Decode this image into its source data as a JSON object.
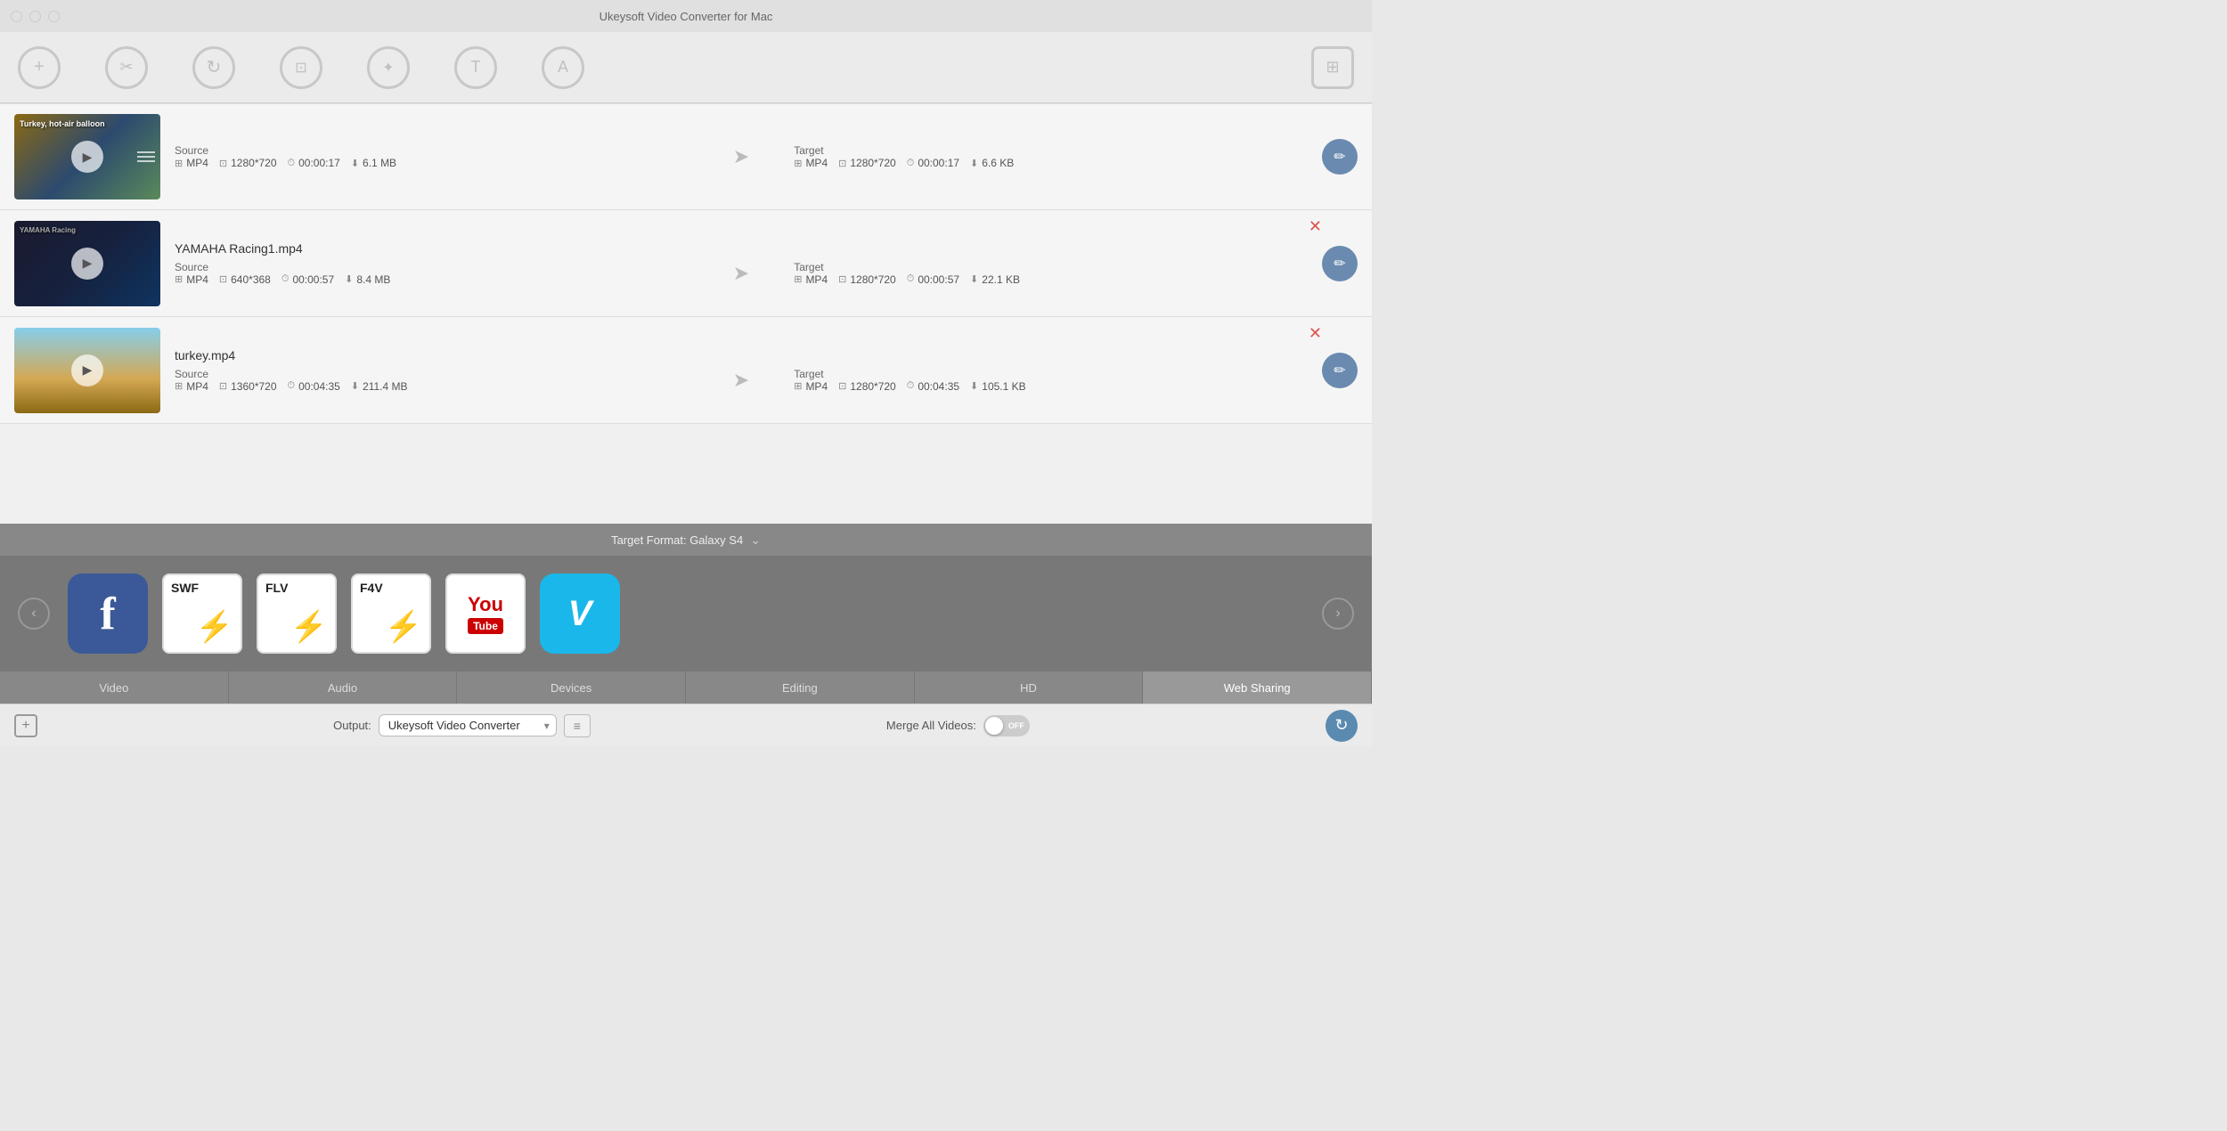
{
  "app": {
    "title": "Ukeysoft Video Converter for Mac"
  },
  "toolbar": {
    "icons": [
      {
        "name": "add-icon",
        "symbol": "+",
        "label": "Add"
      },
      {
        "name": "cut-icon",
        "symbol": "✂",
        "label": "Cut"
      },
      {
        "name": "convert-icon",
        "symbol": "↻",
        "label": "Convert"
      },
      {
        "name": "crop-icon",
        "symbol": "⊡",
        "label": "Crop"
      },
      {
        "name": "effect-icon",
        "symbol": "✦",
        "label": "Effect"
      },
      {
        "name": "text-icon",
        "symbol": "T",
        "label": "Text"
      },
      {
        "name": "watermark-icon",
        "symbol": "A",
        "label": "Watermark"
      }
    ],
    "right_icon": {
      "name": "settings-icon",
      "symbol": "⊞"
    }
  },
  "videos": [
    {
      "id": 1,
      "name": "",
      "thumbnail_text": "Turkey, hot-air balloon",
      "has_close": false,
      "source": {
        "format": "MP4",
        "resolution": "1280*720",
        "duration": "00:00:17",
        "size": "6.1 MB"
      },
      "target": {
        "format": "MP4",
        "resolution": "1280*720",
        "duration": "00:00:17",
        "size": "6.6 KB"
      }
    },
    {
      "id": 2,
      "name": "YAMAHA Racing1.mp4",
      "thumbnail_text": "",
      "has_close": true,
      "source": {
        "format": "MP4",
        "resolution": "640*368",
        "duration": "00:00:57",
        "size": "8.4 MB"
      },
      "target": {
        "format": "MP4",
        "resolution": "1280*720",
        "duration": "00:00:57",
        "size": "22.1 KB"
      }
    },
    {
      "id": 3,
      "name": "turkey.mp4",
      "thumbnail_text": "",
      "has_close": true,
      "source": {
        "format": "MP4",
        "resolution": "1360*720",
        "duration": "00:04:35",
        "size": "211.4 MB"
      },
      "target": {
        "format": "MP4",
        "resolution": "1280*720",
        "duration": "00:04:35",
        "size": "105.1 KB"
      }
    }
  ],
  "format_bar": {
    "label": "Target Format: Galaxy S4"
  },
  "format_icons": [
    {
      "name": "facebook",
      "label": "Facebook"
    },
    {
      "name": "swf",
      "label": "SWF"
    },
    {
      "name": "flv",
      "label": "FLV"
    },
    {
      "name": "f4v",
      "label": "F4V"
    },
    {
      "name": "youtube",
      "label": "YouTube"
    },
    {
      "name": "vimeo",
      "label": "Vimeo"
    }
  ],
  "tabs": [
    {
      "label": "Video",
      "active": false
    },
    {
      "label": "Audio",
      "active": false
    },
    {
      "label": "Devices",
      "active": false
    },
    {
      "label": "Editing",
      "active": false
    },
    {
      "label": "HD",
      "active": false
    },
    {
      "label": "Web Sharing",
      "active": true
    }
  ],
  "bottom_bar": {
    "output_label": "Output:",
    "output_value": "Ukeysoft Video Converter",
    "merge_label": "Merge All Videos:",
    "toggle_state": "OFF"
  },
  "labels": {
    "source": "Source",
    "target": "Target"
  }
}
